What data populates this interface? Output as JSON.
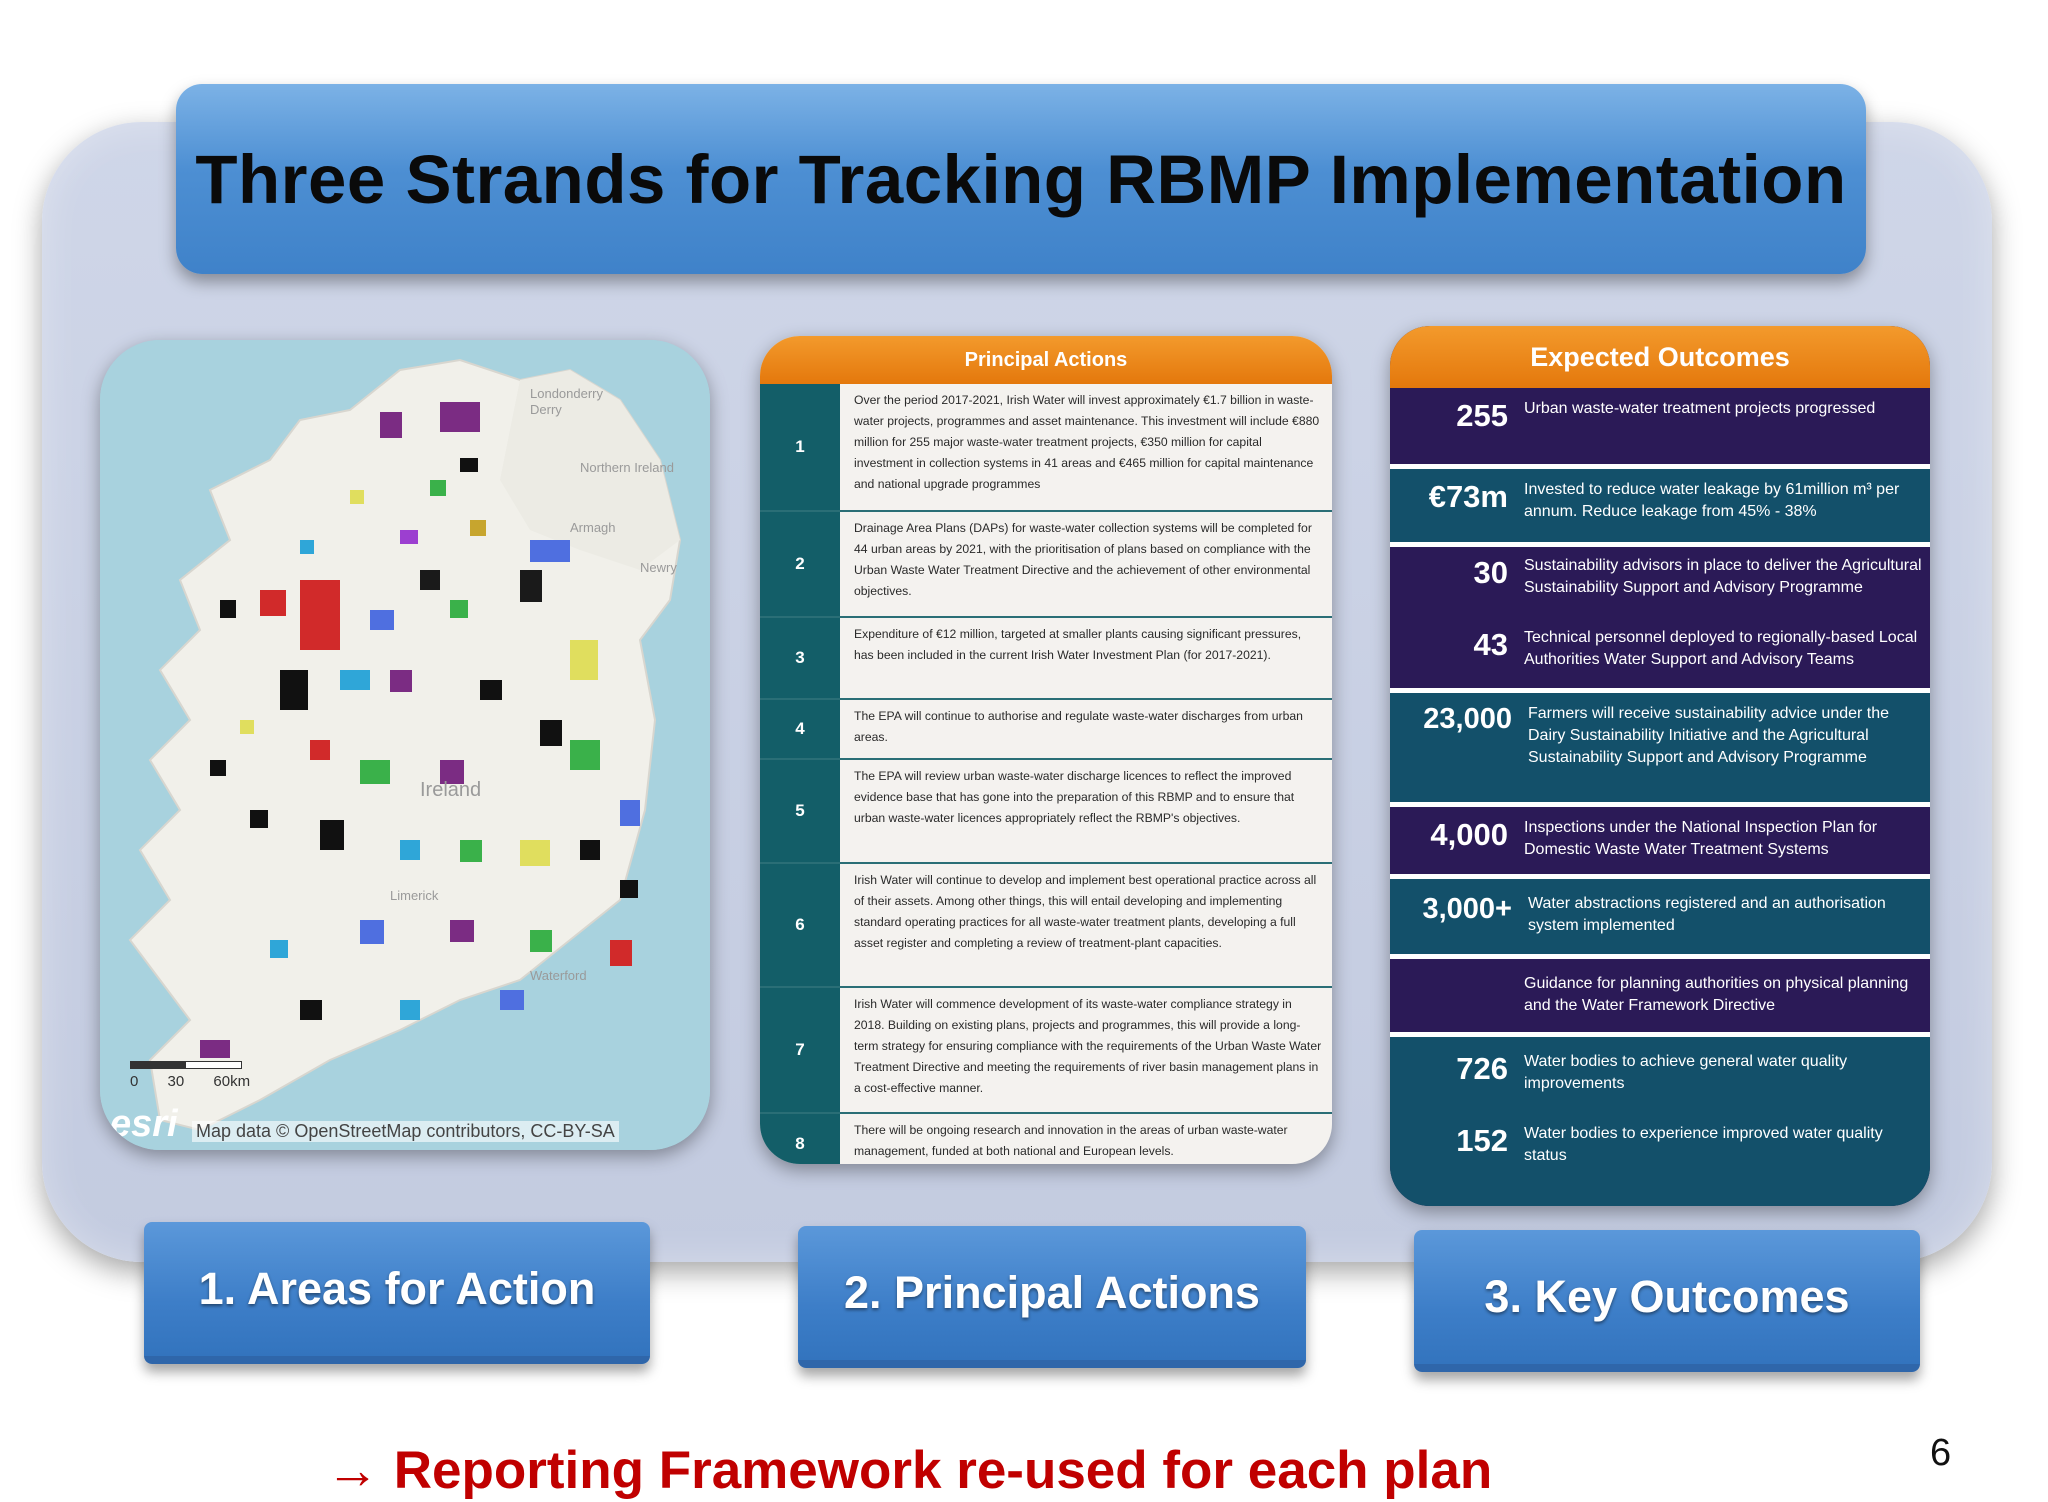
{
  "slide": {
    "title": "Three Strands for Tracking RBMP Implementation",
    "footer_note": "→ Reporting Framework re-used for each plan",
    "page_number": "6"
  },
  "map": {
    "credit": "Map data © OpenStreetMap contributors, CC-BY-SA",
    "logo": "esri",
    "scale_labels": [
      "0",
      "30",
      "60km"
    ],
    "place_labels": [
      "Londonderry",
      "Derry",
      "Northern Ireland",
      "Armagh",
      "Newry",
      "Ireland",
      "Limerick",
      "Waterford"
    ]
  },
  "principal_actions": {
    "header": "Principal Actions",
    "rows": [
      {
        "num": "1",
        "text": "Over the period 2017-2021, Irish Water will invest approximately €1.7 billion in waste-water projects, programmes and asset maintenance. This investment will include €880 million for 255 major waste-water treatment projects, €350 million for capital investment in collection systems in 41 areas and €465 million for capital maintenance and national upgrade programmes"
      },
      {
        "num": "2",
        "text": "Drainage Area Plans (DAPs) for waste-water collection systems will be completed for 44 urban areas by 2021, with the prioritisation of plans based on compliance with the Urban Waste Water Treatment Directive and the achievement of other environmental objectives."
      },
      {
        "num": "3",
        "text": "Expenditure of €12 million, targeted at smaller plants causing significant pressures, has been included in the current Irish Water Investment Plan (for 2017-2021)."
      },
      {
        "num": "4",
        "text": "The EPA will continue to authorise and regulate waste-water discharges from urban areas."
      },
      {
        "num": "5",
        "text": "The EPA will review urban waste-water discharge licences to reflect the improved evidence base that has gone into the preparation of this RBMP and to ensure that urban waste-water licences appropriately reflect the RBMP's objectives."
      },
      {
        "num": "6",
        "text": "Irish Water will continue to develop and implement best operational practice across all of their assets. Among other things, this will entail developing and implementing standard operating practices for all waste-water treatment plants, developing a full asset register and completing a review of treatment-plant capacities."
      },
      {
        "num": "7",
        "text": "Irish Water will commence development of its waste-water compliance strategy in 2018. Building on existing plans, projects and programmes, this will provide a long-term strategy for ensuring compliance with the requirements of the Urban Waste Water Treatment Directive and meeting the requirements of river basin management plans in a cost-effective manner."
      },
      {
        "num": "8",
        "text": "There will be ongoing research and innovation in the areas of urban waste-water management, funded at both national and European levels."
      }
    ]
  },
  "expected_outcomes": {
    "header": "Expected Outcomes",
    "rows": [
      {
        "style": "purple",
        "items": [
          {
            "num": "255",
            "text": "Urban waste-water treatment projects progressed"
          }
        ]
      },
      {
        "style": "teal",
        "items": [
          {
            "num": "€73m",
            "text": "Invested to reduce water leakage by 61million m³ per annum. Reduce leakage from 45% - 38%"
          }
        ]
      },
      {
        "style": "purple",
        "items": [
          {
            "num": "30",
            "text": "Sustainability advisors in place to deliver the Agricultural Sustainability Support and Advisory Programme"
          },
          {
            "num": "43",
            "text": "Technical personnel deployed to regionally-based Local Authorities Water Support and Advisory Teams"
          }
        ]
      },
      {
        "style": "teal",
        "items": [
          {
            "num": "23,000",
            "text": "Farmers will receive sustainability advice under the Dairy Sustainability Initiative and the Agricultural Sustainability Support and Advisory Programme"
          }
        ]
      },
      {
        "style": "purple",
        "items": [
          {
            "num": "4,000",
            "text": "Inspections under the National Inspection Plan for Domestic Waste Water Treatment Systems"
          }
        ]
      },
      {
        "style": "teal",
        "items": [
          {
            "num": "3,000+",
            "text": "Water abstractions registered and an authorisation system implemented"
          }
        ]
      },
      {
        "style": "purple",
        "items": [
          {
            "num": "",
            "text": "Guidance for planning authorities on physical planning and the Water Framework Directive"
          }
        ]
      },
      {
        "style": "teal",
        "items": [
          {
            "num": "726",
            "text": "Water bodies to achieve general water quality improvements"
          },
          {
            "num": "152",
            "text": "Water bodies to experience improved water quality status"
          }
        ]
      }
    ]
  },
  "strands": [
    {
      "label": "1. Areas for Action"
    },
    {
      "label": "2. Principal Actions"
    },
    {
      "label": "3. Key Outcomes"
    }
  ]
}
